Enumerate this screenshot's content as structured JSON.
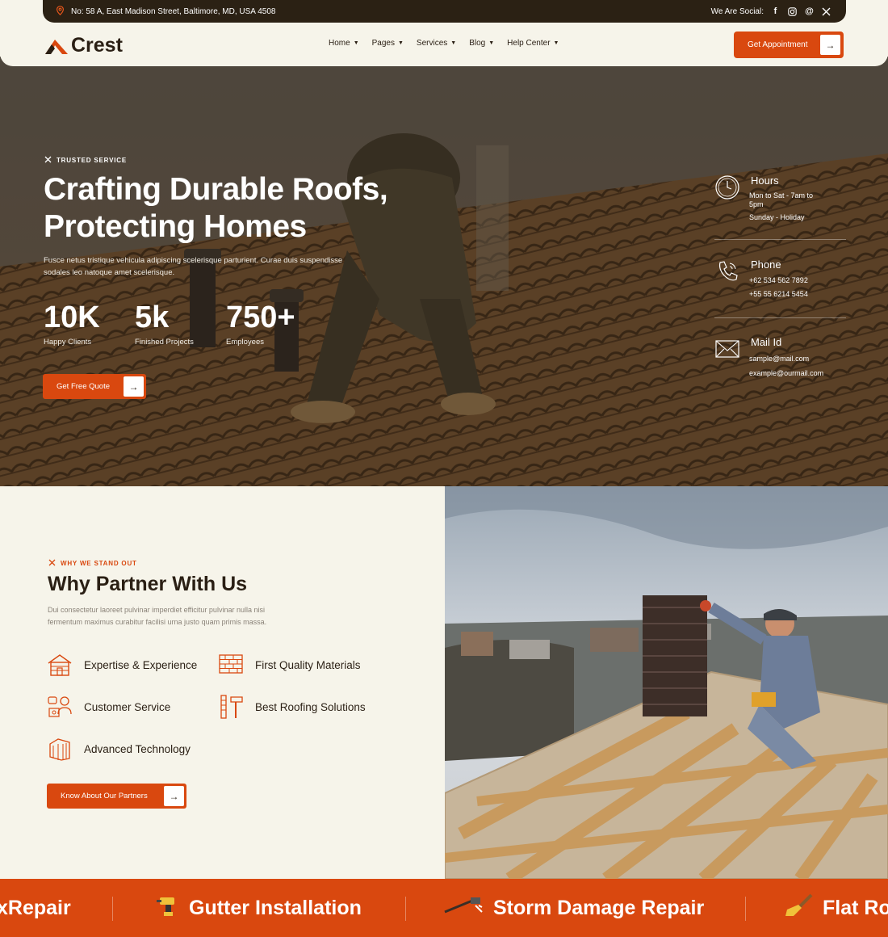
{
  "topbar": {
    "address": "No: 58 A, East Madison Street, Baltimore, MD, USA 4508",
    "social_label": "We Are Social:",
    "social_icons": [
      "facebook-icon",
      "instagram-icon",
      "threads-icon",
      "x-icon"
    ]
  },
  "header": {
    "logo_text": "Crest",
    "nav": [
      {
        "label": "Home"
      },
      {
        "label": "Pages"
      },
      {
        "label": "Services"
      },
      {
        "label": "Blog"
      },
      {
        "label": "Help Center"
      }
    ],
    "cta_label": "Get Appointment"
  },
  "hero": {
    "tagline": "TRUSTED SERVICE",
    "title_line1": "Crafting Durable Roofs,",
    "title_line2": "Protecting Homes",
    "description_line1": "Fusce netus tristique vehicula adipiscing scelerisque parturient. Curae duis suspendisse",
    "description_line2": "sodales leo natoque amet scelerisque.",
    "stats": [
      {
        "value": "10K",
        "label": "Happy Clients"
      },
      {
        "value": "5k",
        "label": "Finished Projects"
      },
      {
        "value": "750+",
        "label": "Employees"
      }
    ],
    "cta_label": "Get Free Quote",
    "info": {
      "hours_title": "Hours",
      "hours_line1": "Mon to Sat - 7am to",
      "hours_line2": "5pm",
      "hours_line3": "Sunday - Holiday",
      "phone_title": "Phone",
      "phone1": "+62 534 562 7892",
      "phone2": "+55 55 6214 5454",
      "mail_title": "Mail Id",
      "mail1": "sample@mail.com",
      "mail2": "example@ourmail.com"
    }
  },
  "why": {
    "tagline": "WHY WE STAND OUT",
    "title": "Why Partner With Us",
    "description_line1": "Dui consectetur laoreet pulvinar imperdiet efficitur pulvinar nulla nisi",
    "description_line2": "fermentum maximus curabitur facilisi urna justo quam primis massa.",
    "features": [
      {
        "label": "Expertise & Experience",
        "icon": "house-icon"
      },
      {
        "label": "First Quality Materials",
        "icon": "bricks-icon"
      },
      {
        "label": "Customer Service",
        "icon": "support-icon"
      },
      {
        "label": "Best Roofing Solutions",
        "icon": "tools-icon"
      },
      {
        "label": "Advanced Technology",
        "icon": "frame-icon"
      }
    ],
    "cta_label": "Know About Our Partners"
  },
  "marquee": {
    "items": [
      {
        "label": "Repair",
        "prefix": "x ",
        "icon": ""
      },
      {
        "label": "Gutter Installation",
        "prefix": "",
        "icon": "drill-icon"
      },
      {
        "label": "Storm Damage Repair",
        "prefix": "",
        "icon": "hammer-icon"
      },
      {
        "label": "Flat Ro",
        "prefix": "",
        "icon": "brush-icon"
      }
    ]
  },
  "colors": {
    "accent": "#d9480f",
    "dark": "#2b2114",
    "background": "#f6f4ea"
  }
}
